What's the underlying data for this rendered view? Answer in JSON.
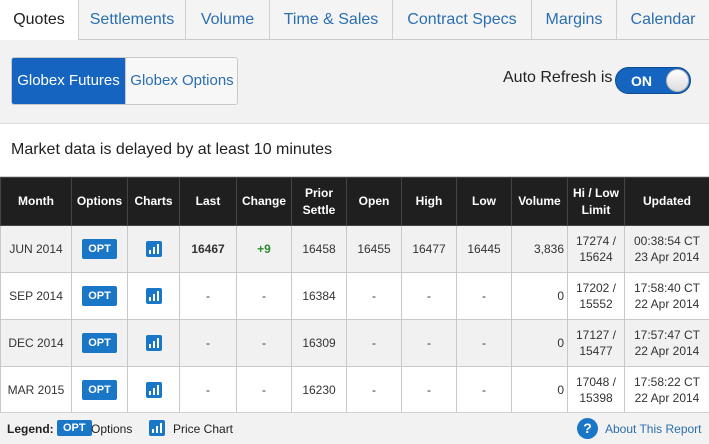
{
  "tabs": [
    {
      "label": "Quotes",
      "active": true
    },
    {
      "label": "Settlements"
    },
    {
      "label": "Volume"
    },
    {
      "label": "Time & Sales"
    },
    {
      "label": "Contract Specs"
    },
    {
      "label": "Margins"
    },
    {
      "label": "Calendar"
    }
  ],
  "toolbar": {
    "seg_futures": "Globex Futures",
    "seg_options": "Globex Options",
    "auto_refresh_label": "Auto Refresh is",
    "toggle_state": "ON"
  },
  "notice": "Market data is delayed by at least 10 minutes",
  "table": {
    "headers": {
      "month": "Month",
      "options": "Options",
      "charts": "Charts",
      "last": "Last",
      "change": "Change",
      "prior_settle": "Prior Settle",
      "open": "Open",
      "high": "High",
      "low": "Low",
      "volume": "Volume",
      "hilo": "Hi / Low Limit",
      "updated": "Updated"
    },
    "opt_badge": "OPT",
    "rows": [
      {
        "month": "JUN 2014",
        "last": "16467",
        "change": "+9",
        "prior": "16458",
        "open": "16455",
        "high": "16477",
        "low": "16445",
        "volume": "3,836",
        "hi": "17274 /",
        "lo": "15624",
        "time": "00:38:54 CT",
        "date": "23 Apr 2014"
      },
      {
        "month": "SEP 2014",
        "last": "-",
        "change": "-",
        "prior": "16384",
        "open": "-",
        "high": "-",
        "low": "-",
        "volume": "0",
        "hi": "17202 /",
        "lo": "15552",
        "time": "17:58:40 CT",
        "date": "22 Apr 2014"
      },
      {
        "month": "DEC 2014",
        "last": "-",
        "change": "-",
        "prior": "16309",
        "open": "-",
        "high": "-",
        "low": "-",
        "volume": "0",
        "hi": "17127 /",
        "lo": "15477",
        "time": "17:57:47 CT",
        "date": "22 Apr 2014"
      },
      {
        "month": "MAR 2015",
        "last": "-",
        "change": "-",
        "prior": "16230",
        "open": "-",
        "high": "-",
        "low": "-",
        "volume": "0",
        "hi": "17048 /",
        "lo": "15398",
        "time": "17:58:22 CT",
        "date": "22 Apr 2014"
      }
    ]
  },
  "legend": {
    "label": "Legend:",
    "opt_badge": "OPT",
    "options_text": "Options",
    "chart_text": "Price Chart",
    "help_glyph": "?",
    "about_link": "About This Report"
  },
  "colors": {
    "accent": "#1565c0",
    "header_bg": "#1f1f1f",
    "positive": "#2e8b2e",
    "link": "#2b6fb0"
  }
}
